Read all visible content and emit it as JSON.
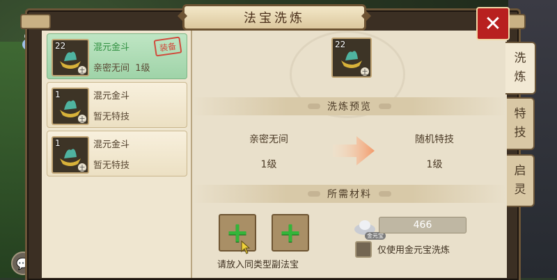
{
  "window": {
    "title": "法宝洗炼",
    "close_label": "✕"
  },
  "side_tabs": [
    {
      "label_line1": "洗",
      "label_line2": "炼",
      "active": true
    },
    {
      "label_line1": "特",
      "label_line2": "技",
      "active": false
    },
    {
      "label_line1": "启",
      "label_line2": "灵",
      "active": false
    }
  ],
  "treasure_list": [
    {
      "level": "22",
      "name": "混元金斗",
      "status": "亲密无间  1级",
      "element": "土",
      "equipped": true,
      "equipped_label": "装备"
    },
    {
      "level": "1",
      "name": "混元金斗",
      "status": "暂无特技",
      "element": "土",
      "equipped": false
    },
    {
      "level": "1",
      "name": "混元金斗",
      "status": "暂无特技",
      "element": "土",
      "equipped": false
    }
  ],
  "selected": {
    "level": "22",
    "element": "土"
  },
  "preview": {
    "header": "洗炼预览",
    "left_name": "亲密无间",
    "left_level": "1级",
    "right_name": "随机特技",
    "right_level": "1级"
  },
  "materials": {
    "header": "所需材料",
    "hint": "请放入同类型副法宝",
    "gold_tag": "金元宝",
    "gold_amount": "466",
    "checkbox_label": "仅使用金元宝洗炼",
    "checked": false
  },
  "colors": {
    "accent_green": "#34b53a",
    "close_red": "#b8201f",
    "equip_red": "#d14b3c"
  }
}
